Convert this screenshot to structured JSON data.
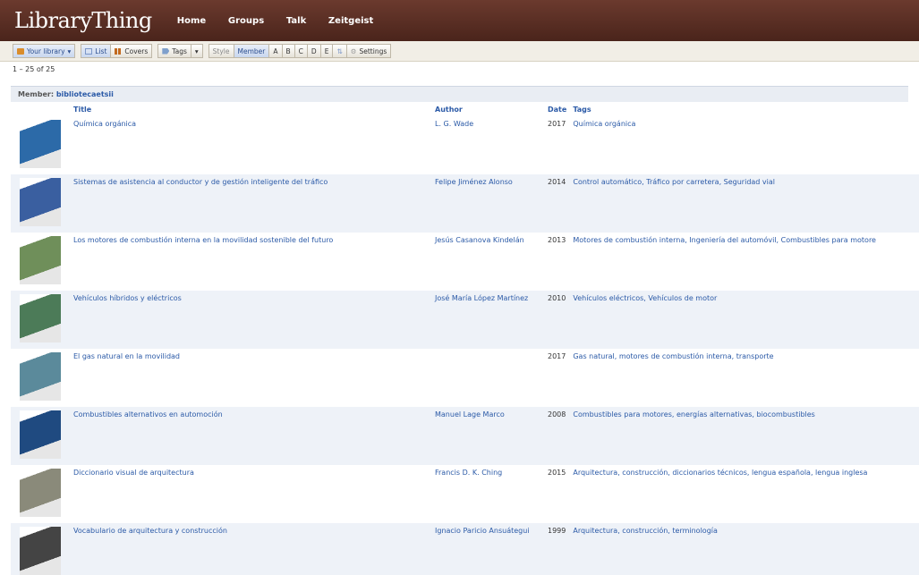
{
  "header": {
    "logo": "LibraryThing",
    "nav": [
      "Home",
      "Groups",
      "Talk",
      "Zeitgeist"
    ]
  },
  "toolbar": {
    "your_library": "Your library",
    "list": "List",
    "covers": "Covers",
    "tags": "Tags",
    "style": "Style",
    "member": "Member",
    "styles": [
      "A",
      "B",
      "C",
      "D",
      "E"
    ],
    "settings": "Settings"
  },
  "count": "1 – 25 of 25",
  "member_label": "Member:",
  "member_name": "bibliotecaetsii",
  "columns": {
    "title": "Title",
    "author": "Author",
    "date": "Date",
    "tags": "Tags"
  },
  "books": [
    {
      "title": "Química orgánica",
      "author": "L. G. Wade",
      "date": "2017",
      "tags": "Química orgánica",
      "cover": "#2c6aa8"
    },
    {
      "title": "Sistemas de asistencia al conductor y de gestión inteligente del tráfico",
      "author": "Felipe Jiménez Alonso",
      "date": "2014",
      "tags": "Control automático, Tráfico por carretera, Seguridad vial",
      "cover": "#3a5fa0"
    },
    {
      "title": "Los motores de combustión interna en la movilidad sostenible del futuro",
      "author": "Jesús Casanova Kindelán",
      "date": "2013",
      "tags": "Motores de combustión interna, Ingeniería del automóvil, Combustibles para motore",
      "cover": "#6f8f5a"
    },
    {
      "title": "Vehículos híbridos y eléctricos",
      "author": "José María López Martínez",
      "date": "2010",
      "tags": "Vehículos eléctricos, Vehículos de motor",
      "cover": "#4c7b58"
    },
    {
      "title": "El gas natural en la movilidad",
      "author": "",
      "date": "2017",
      "tags": "Gas natural, motores de combustión interna, transporte",
      "cover": "#5b8a9b"
    },
    {
      "title": "Combustibles alternativos en automoción",
      "author": "Manuel Lage Marco",
      "date": "2008",
      "tags": "Combustibles para motores, energías alternativas, biocombustibles",
      "cover": "#1f4a80"
    },
    {
      "title": "Diccionario visual de arquitectura",
      "author": "Francis D. K. Ching",
      "date": "2015",
      "tags": "Arquitectura, construcción, diccionarios técnicos, lengua española, lengua inglesa",
      "cover": "#8a8a7a"
    },
    {
      "title": "Vocabulario de arquitectura y construcción",
      "author": "Ignacio Paricio Ansuátegui",
      "date": "1999",
      "tags": "Arquitectura, construcción, terminología",
      "cover": "#444444"
    }
  ],
  "colors": {
    "brand": "#5a2e23",
    "link": "#2b5aa7",
    "row_alt": "#eef2f8"
  }
}
